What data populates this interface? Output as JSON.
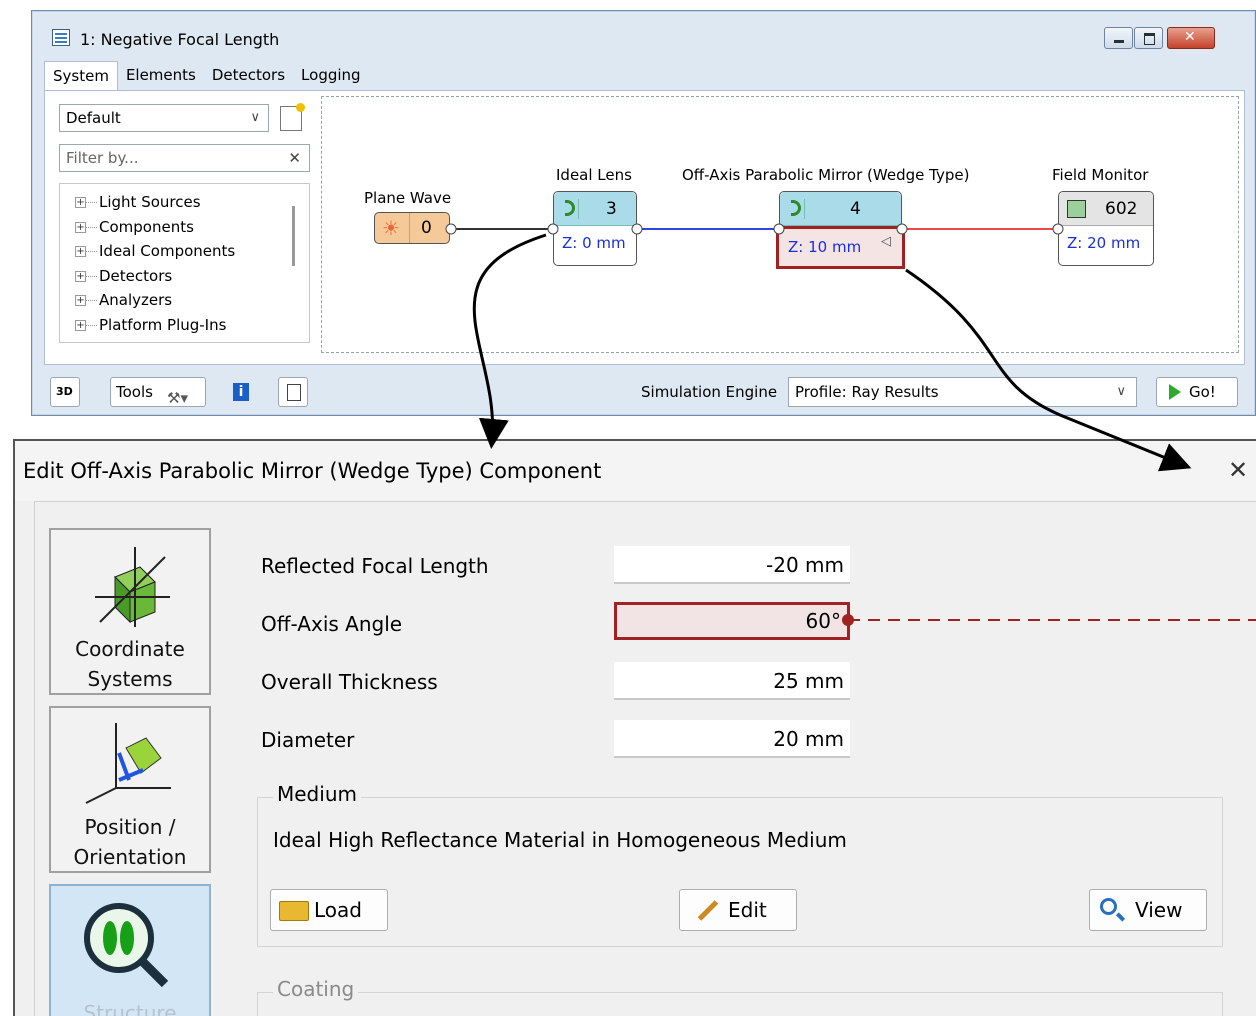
{
  "system_window": {
    "title": "1: Negative Focal Length",
    "tabs": [
      "System",
      "Elements",
      "Detectors",
      "Logging"
    ],
    "preset_select": "Default",
    "filter_placeholder": "Filter by...",
    "tree_items": [
      "Light Sources",
      "Components",
      "Ideal Components",
      "Detectors",
      "Analyzers",
      "Platform Plug-Ins"
    ],
    "nodes": {
      "plane_wave": {
        "label": "Plane Wave",
        "id": "0"
      },
      "ideal_lens": {
        "label": "Ideal Lens",
        "id": "3",
        "z": "Z: 0 mm"
      },
      "mirror": {
        "label": "Off-Axis Parabolic Mirror (Wedge Type)",
        "id": "4",
        "z": "Z: 10 mm"
      },
      "field_monitor": {
        "label": "Field Monitor",
        "id": "602",
        "z": "Z: 20 mm"
      }
    },
    "toolbar": {
      "tools_label": "Tools",
      "info_icon_glyph": "i",
      "simulation_engine_label": "Simulation Engine",
      "simulation_engine_value": "Profile: Ray Results",
      "go_label": "Go!"
    }
  },
  "edit_dialog": {
    "title": "Edit Off-Axis Parabolic Mirror (Wedge Type) Component",
    "sidebar": [
      {
        "line1": "Coordinate",
        "line2": "Systems"
      },
      {
        "line1": "Position /",
        "line2": "Orientation"
      },
      {
        "line1": "Structure"
      }
    ],
    "properties": [
      {
        "label": "Reflected Focal Length",
        "value": "-20 mm"
      },
      {
        "label": "Off-Axis Angle",
        "value": "60°"
      },
      {
        "label": "Overall Thickness",
        "value": "25 mm"
      },
      {
        "label": "Diameter",
        "value": "20 mm"
      }
    ],
    "medium": {
      "legend": "Medium",
      "value": "Ideal High Reflectance Material in Homogeneous Medium",
      "load_label": "Load",
      "edit_label": "Edit",
      "view_label": "View"
    },
    "coating": {
      "legend": "Coating"
    }
  },
  "colors": {
    "highlight_red": "#a02222",
    "wire_blue": "#3344dd",
    "wire_red": "#e84848",
    "z_text_blue": "#1a2ee0",
    "node_top": "#a9dbe8"
  }
}
